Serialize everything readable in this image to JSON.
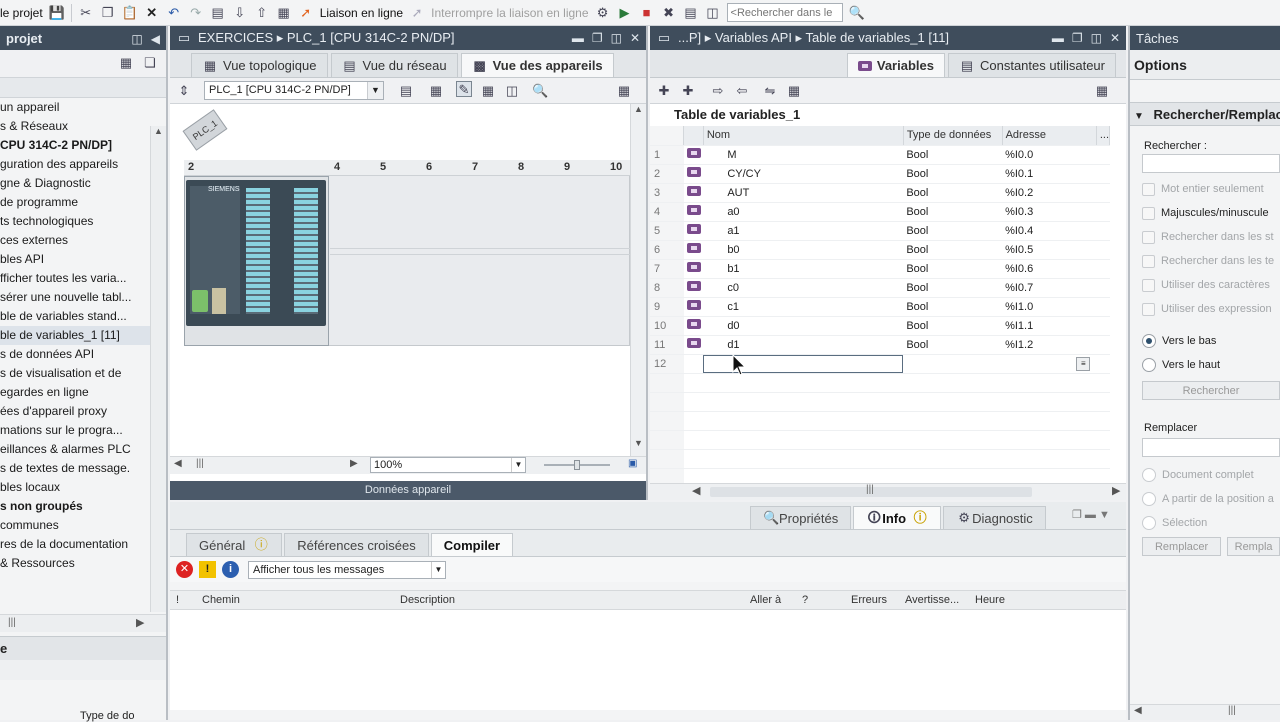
{
  "toolbar": {
    "save_project": "le projet",
    "go_online": "Liaison en ligne",
    "go_offline": "Interrompre la liaison en ligne",
    "search_placeholder": "<Rechercher dans le"
  },
  "project_tree": {
    "title": "projet",
    "items": [
      {
        "label": "un appareil",
        "bold": false,
        "selected": false
      },
      {
        "label": "s & Réseaux",
        "bold": false,
        "selected": false
      },
      {
        "label": "CPU 314C-2 PN/DP]",
        "bold": true,
        "selected": false
      },
      {
        "label": "guration des appareils",
        "bold": false,
        "selected": false
      },
      {
        "label": "gne & Diagnostic",
        "bold": false,
        "selected": false
      },
      {
        "label": " de programme",
        "bold": false,
        "selected": false
      },
      {
        "label": "ts technologiques",
        "bold": false,
        "selected": false
      },
      {
        "label": "ces externes",
        "bold": false,
        "selected": false
      },
      {
        "label": "bles API",
        "bold": false,
        "selected": false
      },
      {
        "label": "fficher toutes les varia...",
        "bold": false,
        "selected": false
      },
      {
        "label": "sérer une nouvelle tabl...",
        "bold": false,
        "selected": false
      },
      {
        "label": "ble de variables stand...",
        "bold": false,
        "selected": false
      },
      {
        "label": "ble de variables_1 [11]",
        "bold": false,
        "selected": true
      },
      {
        "label": "s de données API",
        "bold": false,
        "selected": false
      },
      {
        "label": "s de visualisation et de",
        "bold": false,
        "selected": false
      },
      {
        "label": "egardes en ligne",
        "bold": false,
        "selected": false
      },
      {
        "label": "ées d'appareil proxy",
        "bold": false,
        "selected": false
      },
      {
        "label": "mations sur le progra...",
        "bold": false,
        "selected": false
      },
      {
        "label": "eillances & alarmes PLC",
        "bold": false,
        "selected": false
      },
      {
        "label": "s de textes de message.",
        "bold": false,
        "selected": false
      },
      {
        "label": "bles locaux",
        "bold": false,
        "selected": false
      },
      {
        "label": "s non groupés",
        "bold": true,
        "selected": false
      },
      {
        "label": " communes",
        "bold": false,
        "selected": false
      },
      {
        "label": "res de la documentation",
        "bold": false,
        "selected": false
      },
      {
        "label": " & Ressources",
        "bold": false,
        "selected": false
      }
    ],
    "detail_title": "e",
    "detail_col": "Type de do"
  },
  "device_panel": {
    "title": "EXERCICES ▸ PLC_1 [CPU 314C-2 PN/DP]",
    "tabs": [
      "Vue topologique",
      "Vue du réseau",
      "Vue des appareils"
    ],
    "device_select": "PLC_1 [CPU 314C-2 PN/DP]",
    "plc_label": "PLC_1",
    "slot_numbers": [
      "2",
      "4",
      "5",
      "6",
      "7",
      "8",
      "9",
      "10"
    ],
    "zoom": "100%",
    "footer": "Données appareil"
  },
  "var_panel": {
    "title": "...P] ▸ Variables API ▸ Table de variables_1 [11]",
    "tabs": [
      "Variables",
      "Constantes utilisateur"
    ],
    "table_title": "Table de variables_1",
    "columns": [
      "Nom",
      "Type de données",
      "Adresse",
      "..."
    ],
    "rows": [
      {
        "n": "1",
        "name": "M",
        "type": "Bool",
        "addr": "%I0.0"
      },
      {
        "n": "2",
        "name": "CY/CY",
        "type": "Bool",
        "addr": "%I0.1"
      },
      {
        "n": "3",
        "name": "AUT",
        "type": "Bool",
        "addr": "%I0.2"
      },
      {
        "n": "4",
        "name": "a0",
        "type": "Bool",
        "addr": "%I0.3"
      },
      {
        "n": "5",
        "name": "a1",
        "type": "Bool",
        "addr": "%I0.4"
      },
      {
        "n": "6",
        "name": "b0",
        "type": "Bool",
        "addr": "%I0.5"
      },
      {
        "n": "7",
        "name": "b1",
        "type": "Bool",
        "addr": "%I0.6"
      },
      {
        "n": "8",
        "name": "c0",
        "type": "Bool",
        "addr": "%I0.7"
      },
      {
        "n": "9",
        "name": "c1",
        "type": "Bool",
        "addr": "%I1.0"
      },
      {
        "n": "10",
        "name": "d0",
        "type": "Bool",
        "addr": "%I1.1"
      },
      {
        "n": "11",
        "name": "d1",
        "type": "Bool",
        "addr": "%I1.2"
      }
    ],
    "new_row_number": "12"
  },
  "inspector": {
    "tabs": [
      "Propriétés",
      "Info",
      "Diagnostic"
    ],
    "msg_tabs": [
      "Général",
      "Références croisées",
      "Compiler"
    ],
    "filter": "Afficher tous les messages",
    "columns": [
      "!",
      "Chemin",
      "Description",
      "Aller à",
      "?",
      "Erreurs",
      "Avertisse...",
      "Heure"
    ]
  },
  "tasks": {
    "title": "Tâches",
    "options": "Options",
    "section": "Rechercher/Remplac",
    "search_label": "Rechercher :",
    "checks": [
      {
        "label": "Mot entier seulement",
        "enabled": false
      },
      {
        "label": "Majuscules/minuscule",
        "enabled": true
      },
      {
        "label": "Rechercher dans les st",
        "enabled": false
      },
      {
        "label": "Rechercher dans les te",
        "enabled": false
      },
      {
        "label": "Utiliser des caractères",
        "enabled": false
      },
      {
        "label": "Utiliser des expression",
        "enabled": false
      }
    ],
    "radios": [
      {
        "label": "Vers le bas",
        "checked": true
      },
      {
        "label": "Vers le haut",
        "checked": false
      }
    ],
    "search_btn": "Rechercher",
    "replace_label": "Remplacer",
    "scope": [
      "Document complet",
      "A partir de la position a",
      "Sélection"
    ],
    "replace_btn": "Remplacer",
    "replace_all_btn": "Rempla"
  }
}
